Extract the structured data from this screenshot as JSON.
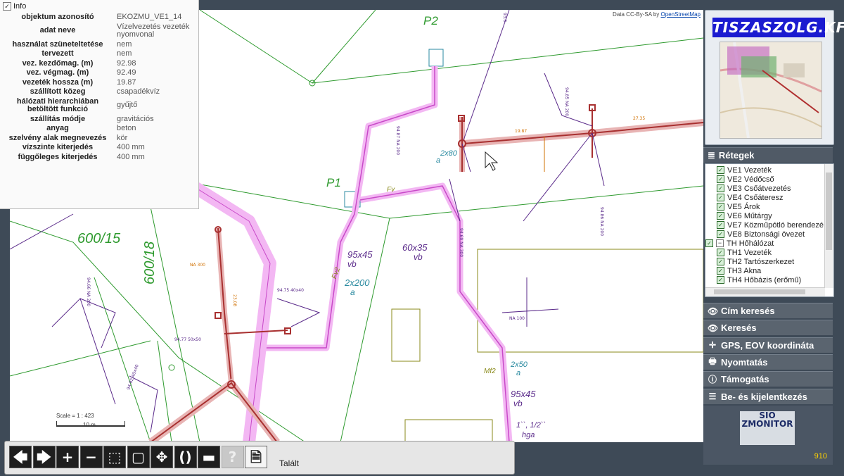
{
  "map": {
    "attribution_prefix": "Data CC-By-SA by ",
    "attribution_link": "OpenStreetMap",
    "labels": {
      "p2": "P2",
      "p1": "P1",
      "parcel_600_15": "600/15",
      "parcel_600_18": "600/18",
      "dim_2x80": "2x80",
      "dim_a1": "a",
      "dim_95x45": "95x45",
      "dim_vb1": "vb",
      "dim_60x35": "60x35",
      "dim_vb2": "vb",
      "dim_2x200": "2x200",
      "dim_a2": "a",
      "fv": "Fv",
      "fv2": "Fv2",
      "dim_2x50": "2x50",
      "dim_a3": "a",
      "dim_95x45b": "95x45",
      "dim_vb3": "vb",
      "mf2": "Mf2",
      "dim_hga_size": "1``, 1/2``",
      "dim_hga": "hga",
      "scale": "Scale = 1 : 423",
      "scale_bar": "10 m"
    }
  },
  "info": {
    "title": "Info",
    "rows": [
      {
        "key": "objektum azonosító",
        "value": "EKOZMU_VE1_14"
      },
      {
        "key": "adat neve",
        "value": "Vízelvezetés vezeték nyomvonal"
      },
      {
        "key": "használat szüneteltetése",
        "value": "nem"
      },
      {
        "key": "tervezett",
        "value": "nem"
      },
      {
        "key": "vez. kezdőmag. (m)",
        "value": "92.98"
      },
      {
        "key": "vez. végmag. (m)",
        "value": "92.49"
      },
      {
        "key": "vezeték hossza (m)",
        "value": "19.87"
      },
      {
        "key": "szállított közeg",
        "value": "csapadékvíz"
      },
      {
        "key": "hálózati hierarchiában betöltött funkció",
        "value": "gyűjtő"
      },
      {
        "key": "szállítás módje",
        "value": "gravitációs"
      },
      {
        "key": "anyag",
        "value": "beton"
      },
      {
        "key": "szelvény alak megnevezés",
        "value": "kör"
      },
      {
        "key": "vízszinte kiterjedés",
        "value": "400 mm"
      },
      {
        "key": "függőleges kiterjedés",
        "value": "400 mm"
      }
    ]
  },
  "right": {
    "logo_text": "TISZASZOLG.KFT.",
    "layers_title": "Rétegek",
    "layers": [
      {
        "label": "VE1 Vezeték",
        "type": "check"
      },
      {
        "label": "VE2 Védőcső",
        "type": "check"
      },
      {
        "label": "VE3 Csőátvezetés",
        "type": "check"
      },
      {
        "label": "VE4 Csőáteresz",
        "type": "check"
      },
      {
        "label": "VE5 Árok",
        "type": "check"
      },
      {
        "label": "VE6 Műtárgy",
        "type": "check"
      },
      {
        "label": "VE7 Közműpótló berendezé",
        "type": "check"
      },
      {
        "label": "VE8 Biztonsági övezet",
        "type": "check"
      },
      {
        "label": "TH Hőhálózat",
        "type": "group"
      },
      {
        "label": "TH1 Vezeték",
        "type": "check"
      },
      {
        "label": "TH2 Tartószerkezet",
        "type": "check"
      },
      {
        "label": "TH3 Akna",
        "type": "check"
      },
      {
        "label": "TH4 Hőbázis (erőmű)",
        "type": "check"
      }
    ],
    "menu": [
      {
        "icon": "eye-icon",
        "glyph": "👁",
        "label": "Cím keresés"
      },
      {
        "icon": "eye-icon",
        "glyph": "👁",
        "label": "Keresés"
      },
      {
        "icon": "crosshair-icon",
        "glyph": "✛",
        "label": "GPS, EOV koordináta"
      },
      {
        "icon": "printer-icon",
        "glyph": "🖶",
        "label": "Nyomtatás"
      },
      {
        "icon": "info-icon",
        "glyph": "ⓘ",
        "label": "Támogatás"
      },
      {
        "icon": "login-icon",
        "glyph": "☰",
        "label": "Be- és kijelentkezés"
      }
    ],
    "banner_text": "SIO ZMONITOR",
    "banner_number": "910"
  },
  "toolbar": {
    "buttons": [
      {
        "name": "back-arrow-button",
        "glyph": "🡄",
        "disabled": false
      },
      {
        "name": "forward-arrow-button",
        "glyph": "🡆",
        "disabled": false
      },
      {
        "name": "zoom-in-button",
        "glyph": "+",
        "disabled": false
      },
      {
        "name": "zoom-out-button",
        "glyph": "−",
        "disabled": false
      },
      {
        "name": "zoom-box-button",
        "glyph": "⬚",
        "disabled": false
      },
      {
        "name": "full-extent-button",
        "glyph": "▢",
        "disabled": false
      },
      {
        "name": "pan-button",
        "glyph": "✥",
        "disabled": false
      },
      {
        "name": "refresh-button",
        "glyph": "()",
        "disabled": false
      },
      {
        "name": "measure-button",
        "glyph": "▬",
        "disabled": false
      },
      {
        "name": "help-button",
        "glyph": "?",
        "disabled": true
      },
      {
        "name": "document-button",
        "glyph": "🗎",
        "disabled": false
      }
    ],
    "status": "Talált"
  }
}
